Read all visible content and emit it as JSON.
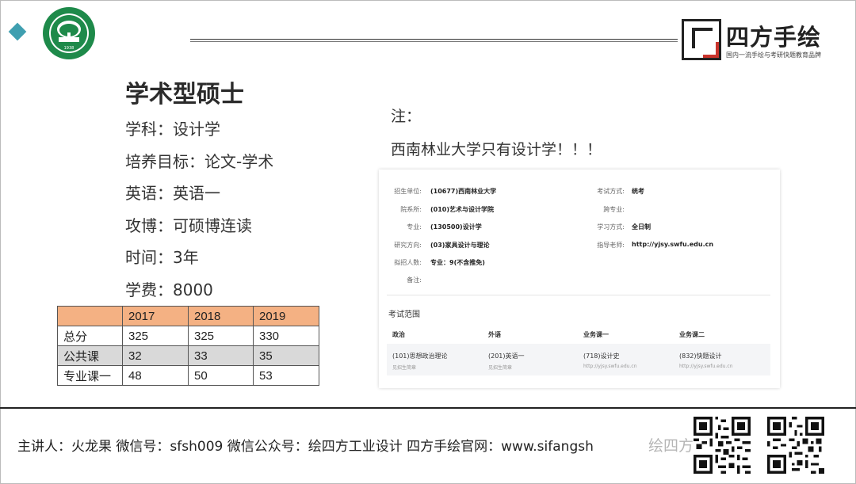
{
  "header": {
    "brand_name": "四方手绘",
    "brand_slogan": "国内一流手绘与考研快题教育品牌",
    "logo_year": "1938"
  },
  "left": {
    "title": "学术型硕士",
    "lines": [
      "学科：设计学",
      "培养目标：论文-学术",
      "英语：英语一",
      "攻博：可硕博连读",
      "时间：3年",
      "学费：8000"
    ]
  },
  "score_table": {
    "headers": [
      "",
      "2017",
      "2018",
      "2019"
    ],
    "rows": [
      [
        "总分",
        "325",
        "325",
        "330"
      ],
      [
        "公共课",
        "32",
        "33",
        "35"
      ],
      [
        "专业课一",
        "48",
        "50",
        "53"
      ]
    ]
  },
  "note": {
    "label": "注：",
    "text": "西南林业大学只有设计学！！！"
  },
  "card": {
    "fields": [
      {
        "label": "招生单位:",
        "value": "(10677)西南林业大学"
      },
      {
        "label": "院系所:",
        "value": "(010)艺术与设计学院"
      },
      {
        "label": "专业:",
        "value": "(130500)设计学"
      },
      {
        "label": "研究方向:",
        "value": "(03)家具设计与理论"
      },
      {
        "label": "拟招人数:",
        "value": "专业：9(不含推免)"
      },
      {
        "label": "备注:",
        "value": ""
      },
      {
        "label": "考试方式:",
        "value": "统考"
      },
      {
        "label": "跨专业:",
        "value": ""
      },
      {
        "label": "学习方式:",
        "value": "全日制"
      },
      {
        "label": "指导老师:",
        "value": "http://yjsy.swfu.edu.cn"
      }
    ],
    "scope_title": "考试范围",
    "scope_headers": [
      "政治",
      "外语",
      "业务课一",
      "业务课二"
    ],
    "scope_subjects": [
      "(101)思想政治理论",
      "(201)英语一",
      "(718)设计史",
      "(832)快题设计"
    ],
    "scope_notes": [
      "见招生简章",
      "见招生简章",
      "http://yjsy.swfu.edu.cn",
      "http://yjsy.swfu.edu.cn"
    ]
  },
  "footer": {
    "text": "主讲人：火龙果   微信号：sfsh009   微信公众号：绘四方工业设计   四方手绘官网：www.sifangsh",
    "watermark": "绘四方工业设"
  },
  "colors": {
    "table_header": "#f4b183",
    "table_shade": "#d9d9d9",
    "accent_diamond": "#3f9fb0",
    "logo_green": "#1e8a4a",
    "brand_red": "#c9342c"
  }
}
